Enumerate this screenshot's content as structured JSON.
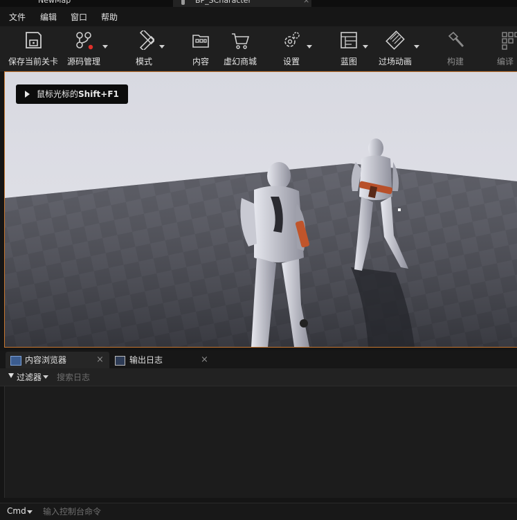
{
  "tabs": {
    "map": "NewMap",
    "character": "BP_SCharacter",
    "close": "×"
  },
  "menu": [
    "文件",
    "编辑",
    "窗口",
    "帮助"
  ],
  "toolbar": {
    "save": "保存当前关卡",
    "source": "源码管理",
    "modes": "模式",
    "content": "内容",
    "marketplace": "虚幻商城",
    "settings": "设置",
    "blueprints": "蓝图",
    "cinematics": "过场动画",
    "build": "构建",
    "compile": "编译"
  },
  "viewport": {
    "hint_prefix": "鼠标光标的",
    "hint_key": "Shift+F1"
  },
  "panel": {
    "tab_content_browser": "内容浏览器",
    "tab_output_log": "输出日志",
    "close": "×",
    "filter_label": "过滤器",
    "search_placeholder": "搜索日志"
  },
  "console": {
    "cmd_label": "Cmd",
    "placeholder": "输入控制台命令"
  },
  "colors": {
    "accent_orange": "#c7772f",
    "source_dot": "#e0302a",
    "viewport_sky": "#dfe0e6"
  }
}
